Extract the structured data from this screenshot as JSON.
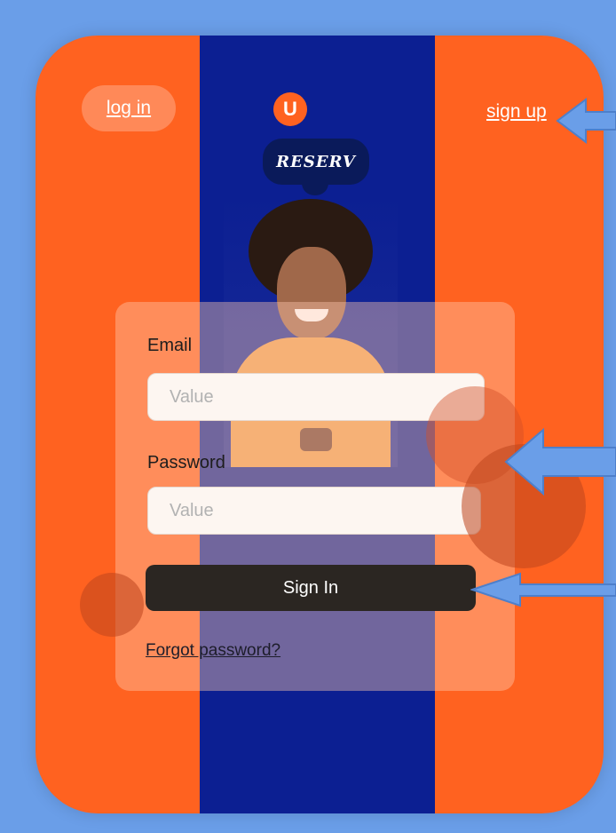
{
  "header": {
    "login_label": "log in",
    "signup_label": "sign up"
  },
  "brand": {
    "logo_letter": "U",
    "name": "RESERV"
  },
  "form": {
    "email_label": "Email",
    "email_placeholder": "Value",
    "password_label": "Password",
    "password_placeholder": "Value",
    "signin_label": "Sign In",
    "forgot_label": "Forgot password?"
  },
  "colors": {
    "background": "#6a9ee8",
    "screen_orange": "#ff6220",
    "stripe_navy": "#0c1f92",
    "button_dark": "#2b2622",
    "arrow_blue": "#6a9ee8"
  },
  "icons": [
    "arrow-left-icon"
  ]
}
